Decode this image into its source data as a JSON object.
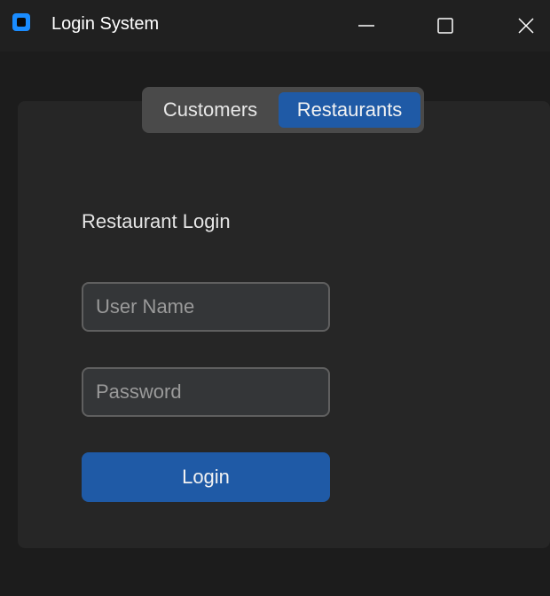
{
  "window": {
    "title": "Login System",
    "icon": "app-icon",
    "controls": [
      "minimize-icon",
      "maximize-icon",
      "close-icon"
    ]
  },
  "tabs": {
    "items": [
      {
        "label": "Customers",
        "selected": false
      },
      {
        "label": "Restaurants",
        "selected": true
      }
    ]
  },
  "form": {
    "heading": "Restaurant Login",
    "username_placeholder": "User Name",
    "username_value": "",
    "password_placeholder": "Password",
    "password_value": "",
    "submit_label": "Login"
  },
  "colors": {
    "accent": "#1f5aa6",
    "app_icon": "#1a8cff",
    "background": "#1c1c1c",
    "panel": "#262626",
    "field_bg": "#343638",
    "field_border": "#5f5f5f"
  }
}
